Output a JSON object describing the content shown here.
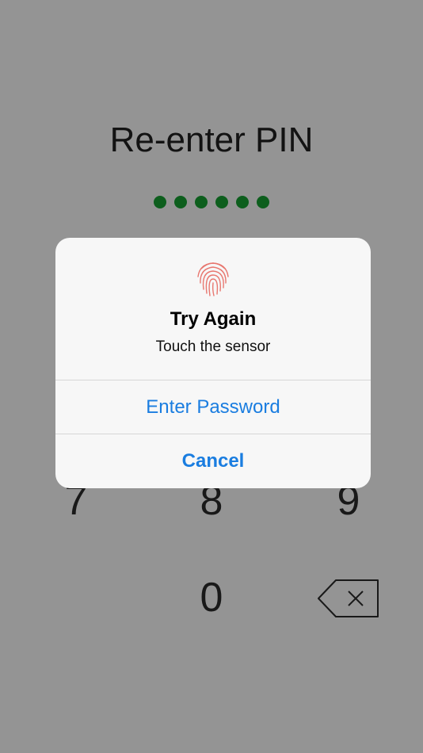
{
  "screen": {
    "title": "Re-enter PIN",
    "pin_dots_filled": 6,
    "dot_color": "#18a233"
  },
  "keypad": {
    "keys": [
      "7",
      "8",
      "9",
      "0"
    ],
    "backspace_icon": "backspace-icon"
  },
  "alert": {
    "icon": "fingerprint-icon",
    "icon_color": "#e8776f",
    "title": "Try Again",
    "message": "Touch the sensor",
    "enter_password_label": "Enter Password",
    "cancel_label": "Cancel",
    "accent_color": "#1a7de0"
  }
}
